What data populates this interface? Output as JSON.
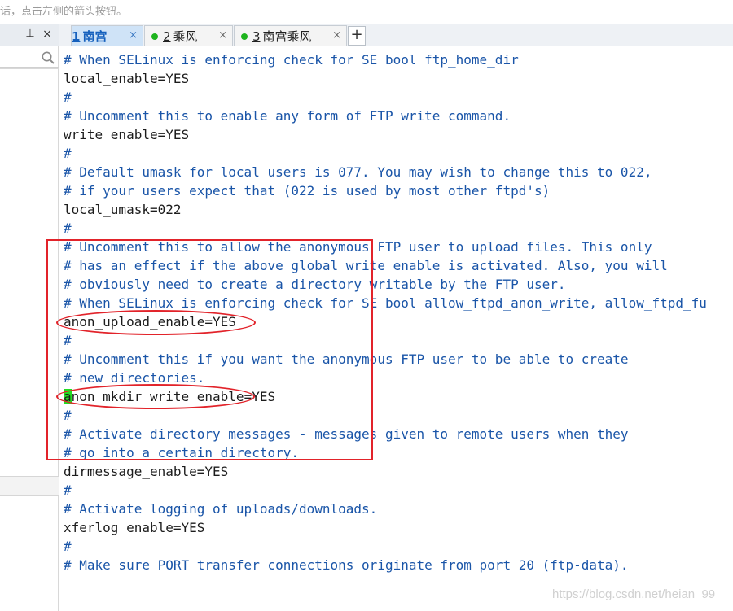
{
  "hint": {
    "text": "话，点击左侧的箭头按钮。"
  },
  "left_panel": {
    "pin_glyph": "⊥",
    "close_glyph": "×",
    "search_icon": "search-icon"
  },
  "tabs": [
    {
      "number": "1",
      "label": "南宫",
      "active": true,
      "close": "×"
    },
    {
      "number": "2",
      "label": "乘风",
      "active": false,
      "close": "×"
    },
    {
      "number": "3",
      "label": "南宫乘风",
      "active": false,
      "close": "×"
    }
  ],
  "add_tab_label": "+",
  "colors": {
    "comment": "#1a55a8",
    "code": "#1c1c1c",
    "highlight": "#e2232a",
    "modified_dot": "#1db31d",
    "cursor": "#22dd22"
  },
  "editor": {
    "lines": [
      {
        "text": "# When SELinux is enforcing check for SE bool ftp_home_dir",
        "kind": "comment"
      },
      {
        "text": "local_enable=YES",
        "kind": "code"
      },
      {
        "text": "#",
        "kind": "comment"
      },
      {
        "text": "# Uncomment this to enable any form of FTP write command.",
        "kind": "comment"
      },
      {
        "text": "write_enable=YES",
        "kind": "code"
      },
      {
        "text": "#",
        "kind": "comment"
      },
      {
        "text": "# Default umask for local users is 077. You may wish to change this to 022,",
        "kind": "comment"
      },
      {
        "text": "# if your users expect that (022 is used by most other ftpd's)",
        "kind": "comment"
      },
      {
        "text": "local_umask=022",
        "kind": "code"
      },
      {
        "text": "#",
        "kind": "comment"
      },
      {
        "text": "# Uncomment this to allow the anonymous FTP user to upload files. This only",
        "kind": "comment"
      },
      {
        "text": "# has an effect if the above global write enable is activated. Also, you will",
        "kind": "comment"
      },
      {
        "text": "# obviously need to create a directory writable by the FTP user.",
        "kind": "comment"
      },
      {
        "text": "# When SELinux is enforcing check for SE bool allow_ftpd_anon_write, allow_ftpd_fu",
        "kind": "comment"
      },
      {
        "text": "anon_upload_enable=YES",
        "kind": "code"
      },
      {
        "text": "#",
        "kind": "comment"
      },
      {
        "text": "# Uncomment this if you want the anonymous FTP user to be able to create",
        "kind": "comment"
      },
      {
        "text": "# new directories.",
        "kind": "comment"
      },
      {
        "text": "anon_mkdir_write_enable=YES",
        "kind": "code",
        "cursor": true
      },
      {
        "text": "#",
        "kind": "comment"
      },
      {
        "text": "# Activate directory messages - messages given to remote users when they",
        "kind": "comment"
      },
      {
        "text": "# go into a certain directory.",
        "kind": "comment"
      },
      {
        "text": "dirmessage_enable=YES",
        "kind": "code"
      },
      {
        "text": "#",
        "kind": "comment"
      },
      {
        "text": "# Activate logging of uploads/downloads.",
        "kind": "comment"
      },
      {
        "text": "xferlog_enable=YES",
        "kind": "code"
      },
      {
        "text": "#",
        "kind": "comment"
      },
      {
        "text": "# Make sure PORT transfer connections originate from port 20 (ftp-data).",
        "kind": "comment"
      }
    ]
  },
  "watermark": "https://blog.csdn.net/heian_99"
}
